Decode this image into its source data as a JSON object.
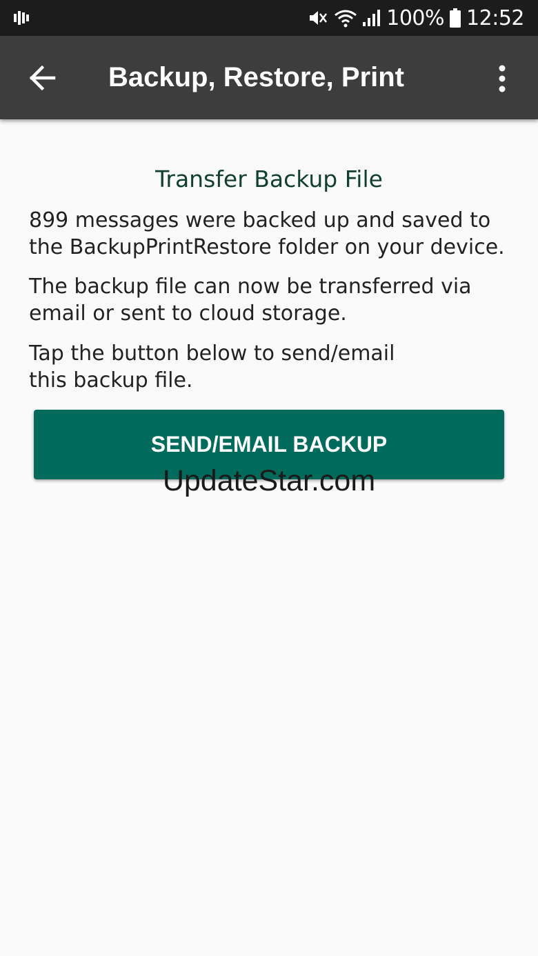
{
  "status_bar": {
    "battery": "100%",
    "time": "12:52",
    "icons": [
      "equalizer-icon",
      "mute-icon",
      "wifi-icon",
      "signal-icon",
      "battery-icon"
    ]
  },
  "app_bar": {
    "title": "Backup, Restore, Print",
    "back_icon": "arrow-left-icon",
    "menu_icon": "more-vert-icon",
    "background": "#3d3d3d"
  },
  "main": {
    "section_title": "Transfer Backup File",
    "paragraphs": [
      {
        "lines": [
          "899 messages were backed up and saved to",
          "the BackupPrintRestore folder on your device."
        ]
      },
      {
        "lines": [
          "The backup file can now be transferred via",
          "email or sent to cloud storage."
        ]
      },
      {
        "lines": [
          "Tap the button below to send/email",
          "this backup file."
        ]
      }
    ],
    "send_button_label": "SEND/EMAIL BACKUP",
    "accent_color": "#006b5b"
  },
  "watermark": "UpdateStar.com"
}
